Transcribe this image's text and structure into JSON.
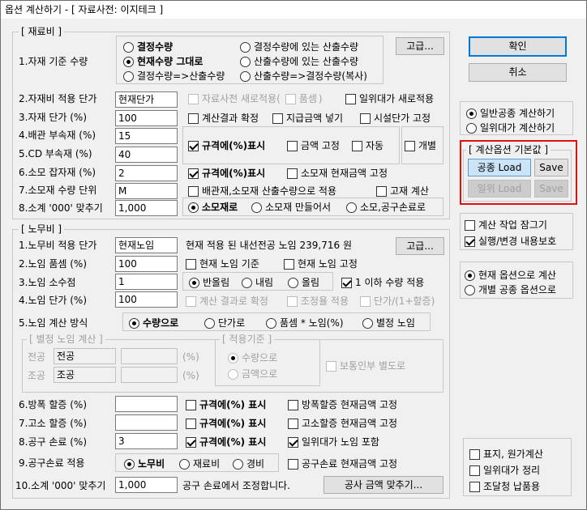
{
  "window": {
    "title": "옵션 계산하기 - [ 자료사전: 이지테크 ]"
  },
  "material": {
    "group_title": "[ 재료비 ]",
    "basis_label": "1.자재 기준 수량",
    "basis_opts": [
      "결정수량",
      "결정수량에 있는 산출수량",
      "현재수량 그대로",
      "산출수량에 있는 산출수량",
      "결정수량=>산출수량",
      "산출수량=>결정수량(복사)"
    ],
    "advanced_btn": "고급...",
    "price_label": "2.자재비 적용 단가",
    "price_value": "현재단가",
    "dict_new_chk": "자료사전 새로적용(",
    "coeff_chk": "품셈",
    "close_paren": ")",
    "labor_new_chk": "일위대가 새로적용",
    "unit_price_label": "3.자재 단가 (%)",
    "unit_price_value": "100",
    "calc_confirm_chk": "계산결과 확정",
    "supply_chk": "지급금액 넣기",
    "facility_chk": "시설단가 고정",
    "pipe_label": "4.배관 부속재 (%)",
    "pipe_value": "15",
    "spec_chk": "규격에(%)표시",
    "fix_amt_chk": "금액 고정",
    "auto_chk": "자동",
    "separate_chk": "개별",
    "cd_label": "5.CD  부속재 (%)",
    "cd_value": "40",
    "misc_label": "6.소모 잡자재 (%)",
    "misc_value": "2",
    "spec2_chk": "규격에(%)표시",
    "consume_fix_chk": "소모재 현재금액 고정",
    "consume_unit_label": "7.소모재 수량 단위",
    "consume_unit_value": "M",
    "pipe_consume_chk": "배관재,소모재 산출수량으로 적용",
    "fixed_calc_chk": "고재 계산",
    "subtotal_label": "8.소계 '000' 맞추기",
    "subtotal_value": "1,000",
    "subtotal_opts": [
      "소모재로",
      "소모재 만들어서",
      "소모,공구손료로"
    ]
  },
  "labor": {
    "group_title": "[ 노무비 ]",
    "price_label": "1.노무비 적용 단가",
    "price_value": "현재노임",
    "price_note": "현재 적용 된 내선전공 노임  239,716 원",
    "advanced_btn": "고급...",
    "coeff_label": "2.노임 품셈 (%)",
    "coeff_value": "100",
    "cur_basis_chk": "현재 노임 기준",
    "cur_fix_chk": "현재 노임 고정",
    "decimal_label": "3.노임 소수점",
    "decimal_value": "1",
    "round_opts": [
      "반올림",
      "내림",
      "올림"
    ],
    "below_one_chk": "1 이하 수량 적용",
    "unit_label": "4.노임 단가 (%)",
    "unit_value": "100",
    "calc_confirm_chk": "계산 결과로 확정",
    "adjust_chk": "조정율 적용",
    "unit_formula_chk": "단가/(1+할증)",
    "method_label": "5.노임 계산 방식",
    "method_opts": [
      "수량으로",
      "단가로",
      "품셈 * 노임(%)",
      "별정 노임"
    ],
    "special_group": "[ 별정 노임 계산 ]",
    "row1_label": "전공",
    "row1_value": "전공",
    "row2_label": "조공",
    "row2_value": "조공",
    "pct": "(%)",
    "basis_group": "[ 적용기준 ]",
    "basis_opts": [
      "수량으로",
      "금액으로"
    ],
    "normal_chk": "보통인부 별도로",
    "anti_label": "6.방폭 할증 (%)",
    "spec_chk": "규격에(%) 표시",
    "anti_fix_chk": "방폭할증 현재금액 고정",
    "high_label": "7.고소 할증 (%)",
    "high_fix_chk": "고소할증 현재금액 고정",
    "tool_label": "8.공구 손료 (%)",
    "tool_value": "3",
    "labor_incl_chk": "일위대가 노임 포함",
    "tool_apply_label": "9.공구손료 적용",
    "tool_apply_opts": [
      "노무비",
      "재료비",
      "경비"
    ],
    "tool_fix_chk": "공구손료 현재금액 고정",
    "subtotal_label": "10.소계 '000' 맞추기",
    "subtotal_value": "1,000",
    "subtotal_note": "공구 손료에서 조정합니다.",
    "fit_btn": "공사 금액 맞추기..."
  },
  "side": {
    "ok": "확인",
    "cancel": "취소",
    "calc_opts": [
      "일반공종 계산하기",
      "일위대가 계산하기"
    ],
    "default_group": "[ 계산옵션 기본값 ]",
    "load1": "공종 Load",
    "save1": "Save",
    "load2": "일위 Load",
    "save2": "Save",
    "lock_chk": "계산 작업 잠그기",
    "protect_chk": "실행/변경 내용보호",
    "mode_opts": [
      "현재 옵션으로 계산",
      "개별 공종 옵션으로"
    ],
    "cover_chk": "표지, 원가계산",
    "arrange_chk": "일위대가 정리",
    "procure_chk": "조달청  납품용"
  }
}
